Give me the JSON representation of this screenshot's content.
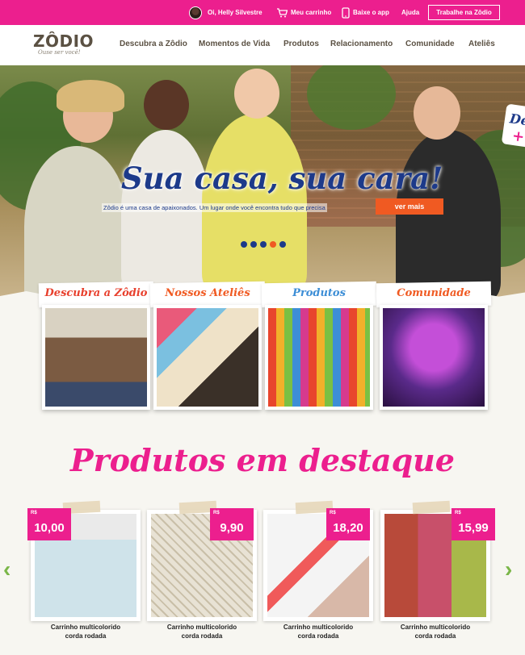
{
  "topbar": {
    "greeting": "Oi, Helly Silvestre",
    "cart": "Meu carrinho",
    "app": "Baixe o app",
    "help": "Ajuda",
    "work": "Trabalhe na Zôdio",
    "color": "#ec1f8e"
  },
  "brand": {
    "name": "ZÔDIO",
    "tagline": "Ouse ser você!"
  },
  "nav": [
    "Descubra a Zôdio",
    "Momentos de Vida",
    "Produtos",
    "Relacionamento",
    "Comunidade",
    "Ateliês"
  ],
  "hero": {
    "title": "Sua casa, sua cara!",
    "subtitle": "Zôdio é uma casa de apaixonados. Um lugar onde você encontra tudo que precisa",
    "cta": "ver mais",
    "side_tab": "De",
    "slide_count": 5,
    "active_slide": 3
  },
  "categories": [
    {
      "label": "Descubra a Zôdio",
      "color": "#e8402d"
    },
    {
      "label": "Nossos Ateliês",
      "color": "#f05a22"
    },
    {
      "label": "Produtos",
      "color": "#3d8ed6"
    },
    {
      "label": "Comunidade",
      "color": "#f05a22"
    }
  ],
  "featured": {
    "title": "Produtos em destaque",
    "currency": "R$",
    "products": [
      {
        "price": "10,00",
        "name_line1": "Carrinho multicolorido",
        "name_line2": "corda rodada"
      },
      {
        "price": "9,90",
        "name_line1": "Carrinho multicolorido",
        "name_line2": "corda rodada"
      },
      {
        "price": "18,20",
        "name_line1": "Carrinho multicolorido",
        "name_line2": "corda rodada"
      },
      {
        "price": "15,99",
        "name_line1": "Carrinho multicolorido",
        "name_line2": "corda rodada"
      }
    ],
    "prev_icon": "chevron-left-icon",
    "next_icon": "chevron-right-icon"
  }
}
